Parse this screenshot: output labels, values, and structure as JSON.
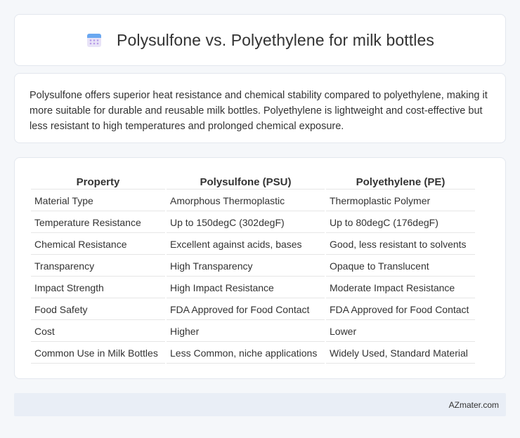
{
  "header": {
    "title": "Polysulfone vs. Polyethylene for milk bottles",
    "icon": "calendar-icon"
  },
  "intro": {
    "text": "Polysulfone offers superior heat resistance and chemical stability compared to polyethylene, making it more suitable for durable and reusable milk bottles. Polyethylene is lightweight and cost-effective but less resistant to high temperatures and prolonged chemical exposure."
  },
  "table": {
    "headers": [
      "Property",
      "Polysulfone (PSU)",
      "Polyethylene (PE)"
    ],
    "rows": [
      [
        "Material Type",
        "Amorphous Thermoplastic",
        "Thermoplastic Polymer"
      ],
      [
        "Temperature Resistance",
        "Up to 150degC (302degF)",
        "Up to 80degC (176degF)"
      ],
      [
        "Chemical Resistance",
        "Excellent against acids, bases",
        "Good, less resistant to solvents"
      ],
      [
        "Transparency",
        "High Transparency",
        "Opaque to Translucent"
      ],
      [
        "Impact Strength",
        "High Impact Resistance",
        "Moderate Impact Resistance"
      ],
      [
        "Food Safety",
        "FDA Approved for Food Contact",
        "FDA Approved for Food Contact"
      ],
      [
        "Cost",
        "Higher",
        "Lower"
      ],
      [
        "Common Use in Milk Bottles",
        "Less Common, niche applications",
        "Widely Used, Standard Material"
      ]
    ]
  },
  "footer": {
    "brand": "AZmater.com"
  }
}
